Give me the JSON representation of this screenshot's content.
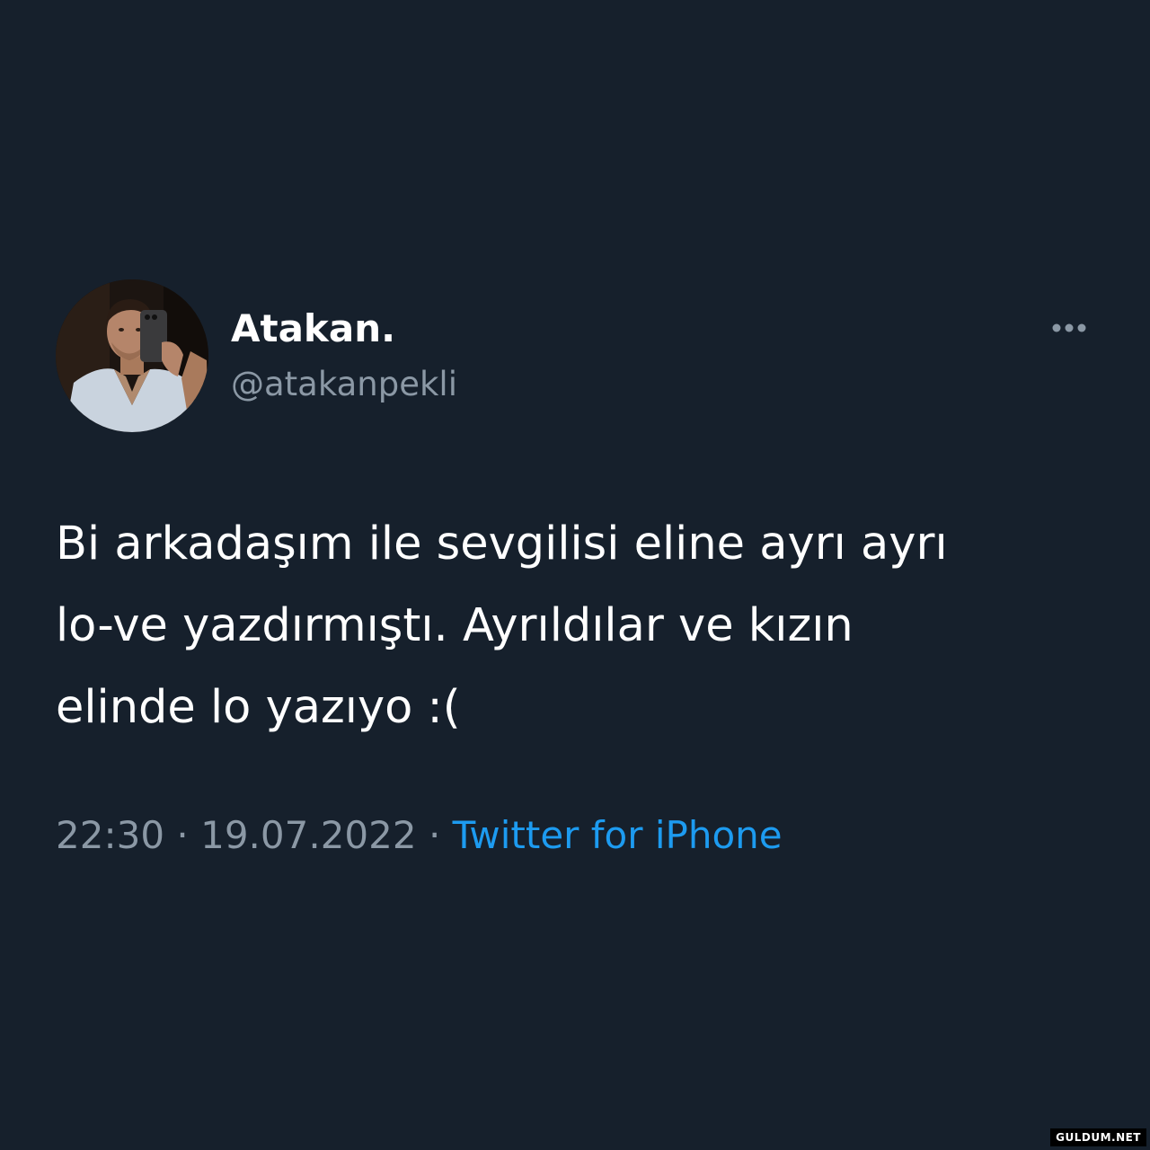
{
  "author": {
    "display_name": "Atakan.",
    "handle": "@atakanpekli",
    "avatar": "profile-photo"
  },
  "menu": {
    "icon": "more-horizontal-icon",
    "glyph": "•••"
  },
  "tweet": {
    "text": "Bi arkadaşım ile sevgilisi eline ayrı ayrı\nlo-ve yazdırmıştı. Ayrıldılar ve kızın\nelinde lo yazıyo :("
  },
  "meta": {
    "time": "22:30",
    "separator": " · ",
    "date": "19.07.2022",
    "source": "Twitter for iPhone"
  },
  "watermark": "GULDUM.NET",
  "colors": {
    "background": "#16202c",
    "text": "#ffffff",
    "secondary": "#8b98a5",
    "link": "#1d9bf0"
  }
}
